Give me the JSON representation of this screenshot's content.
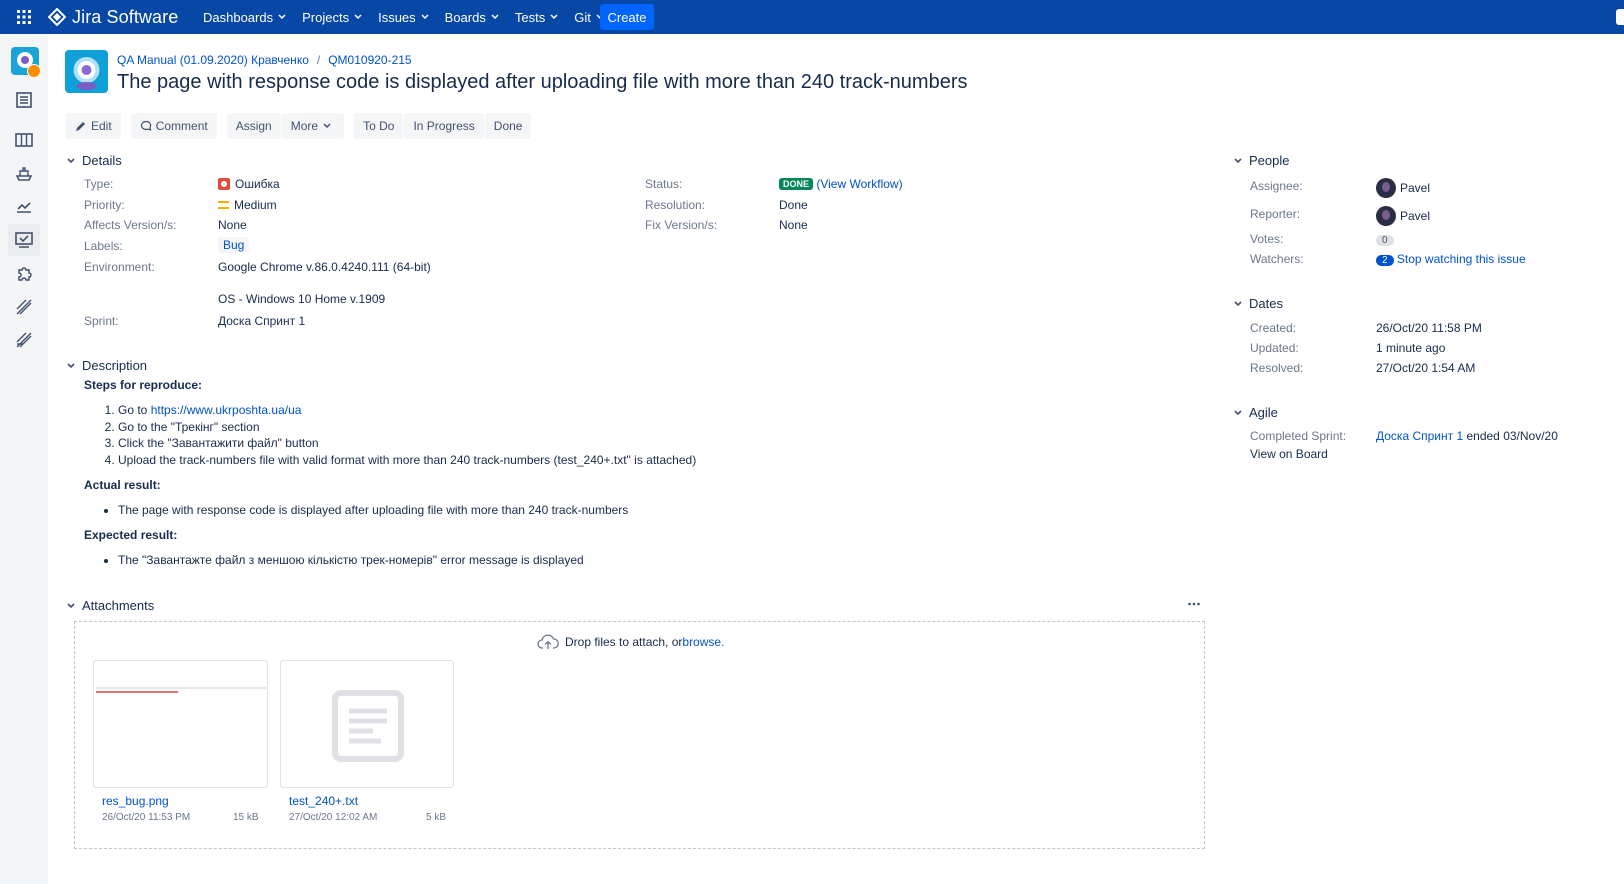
{
  "app": {
    "brand": "Jira Software",
    "nav": [
      "Dashboards",
      "Projects",
      "Issues",
      "Boards",
      "Tests",
      "Git"
    ],
    "create_label": "Create"
  },
  "breadcrumb": {
    "project": "QA Manual (01.09.2020) Кравченко",
    "issue_key": "QM010920-215"
  },
  "issue": {
    "title": "The page with response code is displayed after uploading file with more than 240 track-numbers"
  },
  "toolbar": {
    "edit": "Edit",
    "comment": "Comment",
    "assign": "Assign",
    "more": "More",
    "todo": "To Do",
    "in_progress": "In Progress",
    "done": "Done"
  },
  "details": {
    "heading": "Details",
    "type_label": "Type:",
    "type_value": "Ошибка",
    "priority_label": "Priority:",
    "priority_value": "Medium",
    "affects_label": "Affects Version/s:",
    "affects_value": "None",
    "labels_label": "Labels:",
    "labels_value": "Bug",
    "environment_label": "Environment:",
    "environment_line1": "Google Chrome v.86.0.4240.111 (64-bit)",
    "environment_line2": "OS - Windows 10 Home v.1909",
    "sprint_label": "Sprint:",
    "sprint_value": "Доска Спринт 1",
    "status_label": "Status:",
    "status_value": "DONE",
    "view_workflow": "(View Workflow)",
    "resolution_label": "Resolution:",
    "resolution_value": "Done",
    "fix_label": "Fix Version/s:",
    "fix_value": "None"
  },
  "description": {
    "heading": "Description",
    "steps_heading": "Steps for reproduce:",
    "step1_prefix": "Go to ",
    "step1_link": "https://www.ukrposhta.ua/ua",
    "step2": "Go to the \"Трекінг\" section",
    "step3": "Click the \"Завантажити файл\" button",
    "step4": "Upload the track-numbers file with valid format with more than 240 track-numbers (test_240+.txt\" is attached)",
    "actual_heading": "Actual result:",
    "actual_item": "The page with response code is displayed after uploading file with more than 240 track-numbers",
    "expected_heading": "Expected result:",
    "expected_item": "The \"Завантажте файл з меншою кількістю трек-номерів\" error message is displayed"
  },
  "attachments": {
    "heading": "Attachments",
    "drop_text": "Drop files to attach, or ",
    "browse": "browse.",
    "files": [
      {
        "name": "res_bug.png",
        "date": "26/Oct/20 11:53 PM",
        "size": "15 kB"
      },
      {
        "name": "test_240+.txt",
        "date": "27/Oct/20 12:02 AM",
        "size": "5 kB"
      }
    ]
  },
  "people": {
    "heading": "People",
    "assignee_label": "Assignee:",
    "assignee": "Pavel",
    "reporter_label": "Reporter:",
    "reporter": "Pavel",
    "votes_label": "Votes:",
    "votes": "0",
    "watchers_label": "Watchers:",
    "watchers": "2",
    "stop_watching": "Stop watching this issue"
  },
  "dates": {
    "heading": "Dates",
    "created_label": "Created:",
    "created": "26/Oct/20 11:58 PM",
    "updated_label": "Updated:",
    "updated": "1 minute ago",
    "resolved_label": "Resolved:",
    "resolved": "27/Oct/20 1:54 AM"
  },
  "agile": {
    "heading": "Agile",
    "completed_label": "Completed Sprint:",
    "sprint_link": "Доска Спринт 1",
    "sprint_ended": "ended 03/Nov/20",
    "view_on_board": "View on Board"
  },
  "colors": {
    "topbar": "#0747a6",
    "create": "#0065ff",
    "link": "#0052cc",
    "done_lozenge": "#00875a"
  }
}
